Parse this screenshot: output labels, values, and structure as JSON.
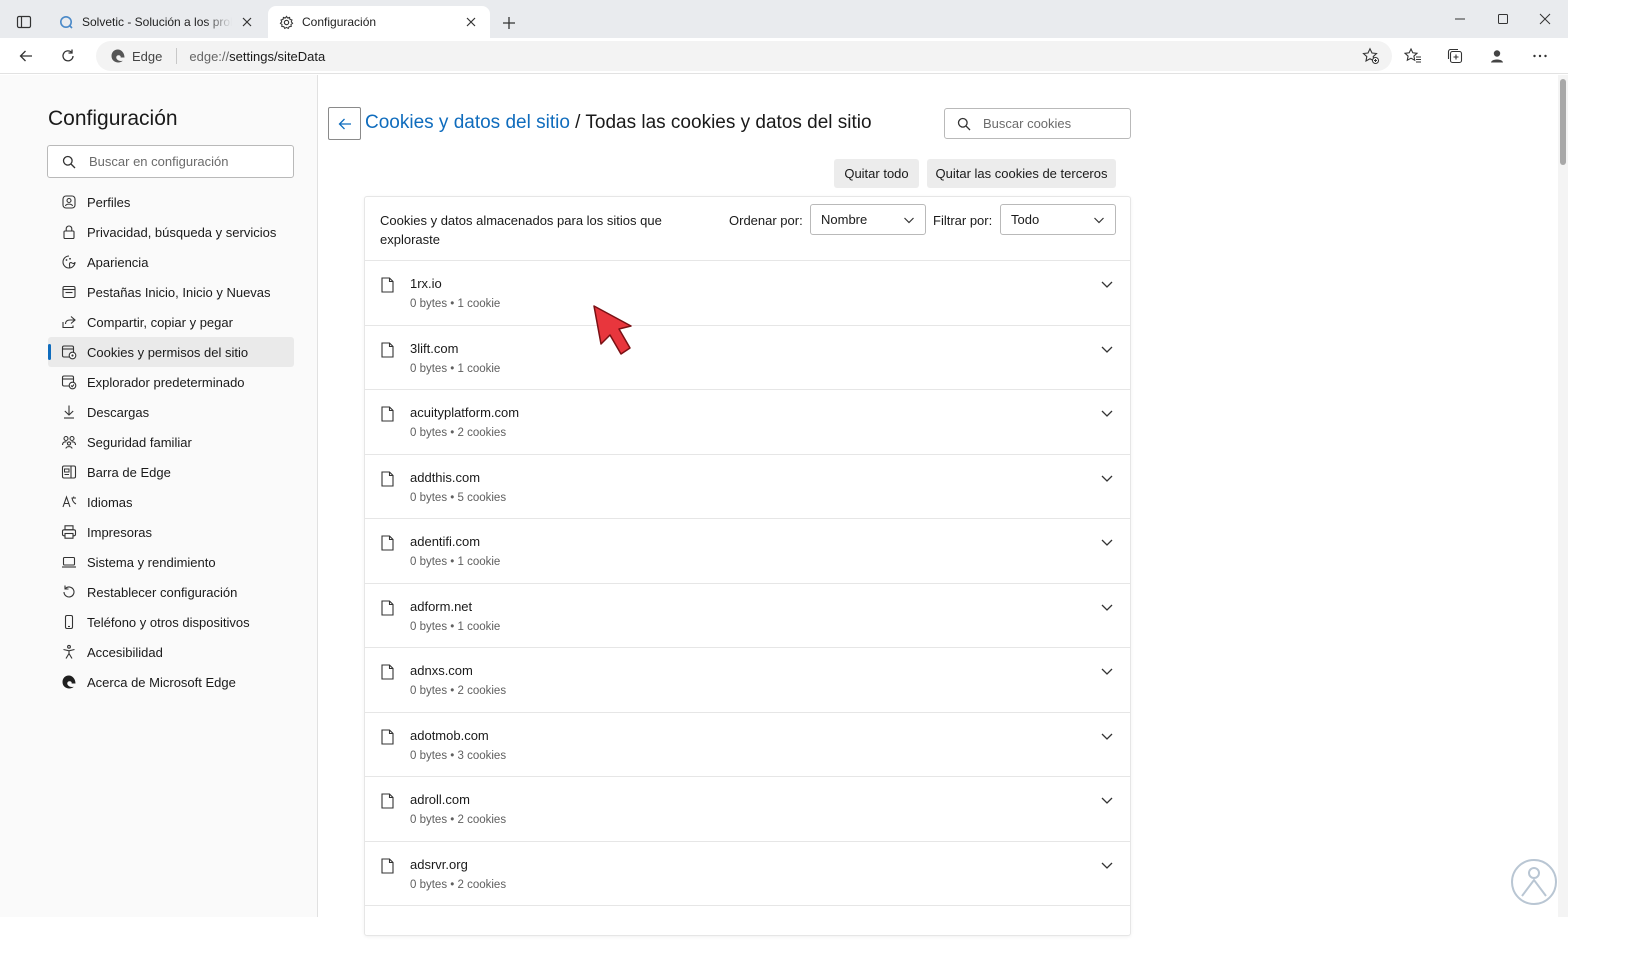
{
  "browser": {
    "tabs": [
      {
        "title": "Solvetic - Solución a los problemas"
      },
      {
        "title": "Configuración"
      }
    ],
    "address": {
      "site_label": "Edge",
      "url_prefix": "edge://",
      "url_path": "settings/siteData"
    }
  },
  "sidebar": {
    "title": "Configuración",
    "search_placeholder": "Buscar en configuración",
    "items": [
      {
        "label": "Perfiles",
        "icon": "profile-icon"
      },
      {
        "label": "Privacidad, búsqueda y servicios",
        "icon": "lock-icon"
      },
      {
        "label": "Apariencia",
        "icon": "appearance-icon"
      },
      {
        "label": "Pestañas Inicio, Inicio y Nuevas",
        "icon": "start-page-icon"
      },
      {
        "label": "Compartir, copiar y pegar",
        "icon": "share-icon"
      },
      {
        "label": "Cookies y permisos del sitio",
        "icon": "site-permissions-icon"
      },
      {
        "label": "Explorador predeterminado",
        "icon": "default-browser-icon"
      },
      {
        "label": "Descargas",
        "icon": "download-icon"
      },
      {
        "label": "Seguridad familiar",
        "icon": "family-icon"
      },
      {
        "label": "Barra de Edge",
        "icon": "edge-bar-icon"
      },
      {
        "label": "Idiomas",
        "icon": "languages-icon"
      },
      {
        "label": "Impresoras",
        "icon": "printer-icon"
      },
      {
        "label": "Sistema y rendimiento",
        "icon": "laptop-icon"
      },
      {
        "label": "Restablecer configuración",
        "icon": "reset-icon"
      },
      {
        "label": "Teléfono y otros dispositivos",
        "icon": "phone-icon"
      },
      {
        "label": "Accesibilidad",
        "icon": "accessibility-icon"
      },
      {
        "label": "Acerca de Microsoft Edge",
        "icon": "edge-logo-icon"
      }
    ],
    "selected_index": 5
  },
  "main": {
    "breadcrumb_link": "Cookies y datos del sitio",
    "breadcrumb_separator": "/",
    "breadcrumb_current": "Todas las cookies y datos del sitio",
    "search_placeholder": "Buscar cookies",
    "remove_all_label": "Quitar todo",
    "remove_third_party_label": "Quitar las cookies de terceros",
    "list_description": "Cookies y datos almacenados para los sitios que exploraste",
    "sort_label": "Ordenar por:",
    "sort_value": "Nombre",
    "filter_label": "Filtrar por:",
    "filter_value": "Todo",
    "sites": [
      {
        "name": "1rx.io",
        "meta": "0 bytes • 1 cookie"
      },
      {
        "name": "3lift.com",
        "meta": "0 bytes • 1 cookie"
      },
      {
        "name": "acuityplatform.com",
        "meta": "0 bytes • 2 cookies"
      },
      {
        "name": "addthis.com",
        "meta": "0 bytes • 5 cookies"
      },
      {
        "name": "adentifi.com",
        "meta": "0 bytes • 1 cookie"
      },
      {
        "name": "adform.net",
        "meta": "0 bytes • 1 cookie"
      },
      {
        "name": "adnxs.com",
        "meta": "0 bytes • 2 cookies"
      },
      {
        "name": "adotmob.com",
        "meta": "0 bytes • 3 cookies"
      },
      {
        "name": "adroll.com",
        "meta": "0 bytes • 2 cookies"
      },
      {
        "name": "adsrvr.org",
        "meta": "0 bytes • 2 cookies"
      }
    ]
  },
  "colors": {
    "accent": "#0f6cbd",
    "pointer": "#e8363d"
  }
}
